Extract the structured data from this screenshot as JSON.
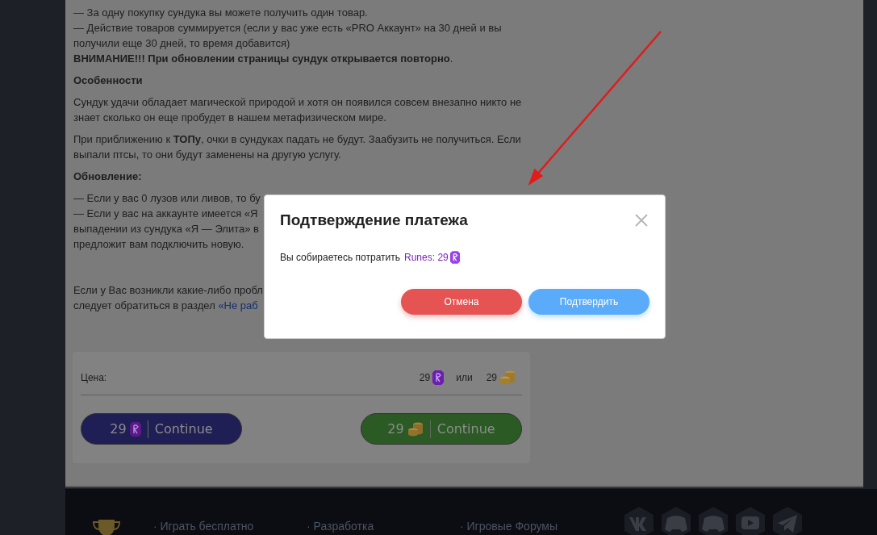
{
  "article": [
    {
      "kind": "paragraph",
      "lines": [
        "— За одну покупку сундука вы можете получить один товар.",
        "— Действие товаров суммируется (если у вас уже есть «PRO Аккаунт» на 30 дней и вы получили еще 30 дней, то время добавится)",
        "**ВНИМАНИЕ!!! При обновлении страницы сундук открывается повторно**."
      ]
    },
    {
      "kind": "heading",
      "lines": [
        "Особенности"
      ]
    },
    {
      "kind": "paragraph",
      "lines": [
        "Сундук удачи обладает магической природой и хотя он появился совсем внезапно никто не знает сколько он еще пробудет в нашем метафизическом мире."
      ]
    },
    {
      "kind": "paragraph",
      "lines": [
        "При приближению к **ТОПу**, очки в сундуках падать не будут. Заабузить не получиться. Если выпали птсы, то они будут заменены на другую услугу."
      ]
    },
    {
      "kind": "heading",
      "lines": [
        "Обновление:"
      ]
    },
    {
      "kind": "clipped",
      "lines": [
        "— Если у вас 0 лузов или ливов, то бу",
        "— Если у вас на аккаунте имеется «Я",
        "выпадении из сундука «Я — Элита» в",
        "предложит вам подключить новую."
      ]
    },
    {
      "kind": "note",
      "lines": [
        "Если у Вас возникли какие-либо пробл",
        "следует обратиться в раздел "
      ],
      "link": "«Не раб"
    }
  ],
  "price": {
    "label": "Цена:",
    "runes": "29",
    "separator": "или",
    "gold": "29"
  },
  "buy_buttons": [
    {
      "kind": "runes",
      "amount": "29",
      "label": "Continue"
    },
    {
      "kind": "gold",
      "amount": "29",
      "label": "Continue"
    }
  ],
  "modal": {
    "title": "Подтверждение платежа",
    "message": "Вы собираетесь потратить",
    "amount": "Runes: 29",
    "buttons": [
      {
        "kind": "cancel",
        "label": "Отмена"
      },
      {
        "kind": "confirm",
        "label": "Подтвердить"
      }
    ]
  },
  "footer": {
    "links": [
      "· Играть бесплатно",
      "· Разработка",
      "· Игровые Форумы"
    ]
  }
}
